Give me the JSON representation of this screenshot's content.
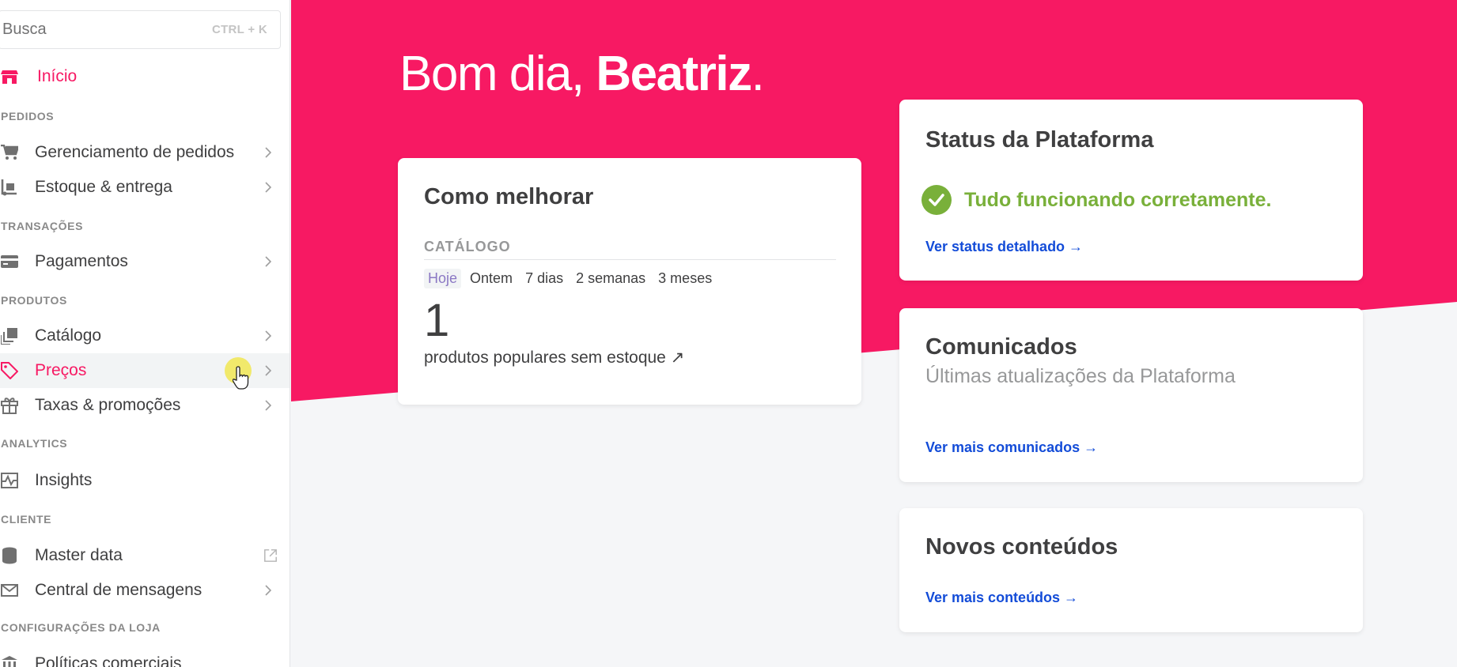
{
  "search": {
    "placeholder": "Busca",
    "shortcut": "CTRL + K"
  },
  "nav": {
    "home": "Início",
    "sections": {
      "pedidos": "PEDIDOS",
      "transacoes": "TRANSAÇÕES",
      "produtos": "PRODUTOS",
      "analytics": "ANALYTICS",
      "cliente": "CLIENTE",
      "config": "CONFIGURAÇÕES DA LOJA"
    },
    "items": {
      "orders": "Gerenciamento de pedidos",
      "inventory": "Estoque & entrega",
      "payments": "Pagamentos",
      "catalog": "Catálogo",
      "prices": "Preços",
      "promotions": "Taxas & promoções",
      "insights": "Insights",
      "masterdata": "Master data",
      "messages": "Central de mensagens",
      "policies": "Políticas comerciais"
    }
  },
  "greeting": {
    "prefix": "Bom dia,",
    "name": "Beatriz",
    "suffix": "."
  },
  "improve_card": {
    "title": "Como melhorar",
    "section": "CATÁLOGO",
    "tabs": [
      "Hoje",
      "Ontem",
      "7 dias",
      "2 semanas",
      "3 meses"
    ],
    "selected_tab": "Hoje",
    "value": "1",
    "metric_label": "produtos populares sem estoque ↗"
  },
  "status_card": {
    "title": "Status da Plataforma",
    "message": "Tudo funcionando corretamente.",
    "link": "Ver status detalhado →"
  },
  "news_card": {
    "title": "Comunicados",
    "subtitle": "Últimas atualizações da Plataforma",
    "link": "Ver mais comunicados →"
  },
  "content_card": {
    "title": "Novos conteúdos",
    "link": "Ver mais conteúdos →"
  },
  "colors": {
    "brand": "#f71963",
    "link": "#134cd8",
    "success": "#79b03a"
  },
  "icons": {
    "home": "store-icon",
    "orders": "cart-icon",
    "inventory": "dolly-icon",
    "payments": "credit-card-icon",
    "catalog": "copy-icon",
    "prices": "tag-icon",
    "promotions": "gift-icon",
    "insights": "chart-pulse-icon",
    "masterdata": "database-icon",
    "messages": "envelope-icon",
    "policies": "bank-icon"
  }
}
